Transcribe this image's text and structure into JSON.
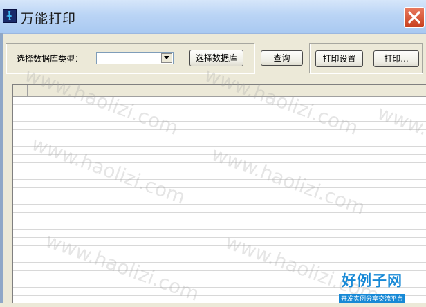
{
  "window": {
    "title": "万能打印",
    "close_icon": "close-icon",
    "app_icon": "app-icon"
  },
  "toolbar": {
    "db_type_label": "选择数据库类型：",
    "db_type_value": "",
    "select_db_button": "选择数据库",
    "query_button": "查询",
    "print_settings_button": "打印设置",
    "print_button": "打印..."
  },
  "watermark": {
    "text": "www.haolizi.com",
    "logo_main": "好例子网",
    "logo_sub": "开发实例分享交流平台"
  },
  "colors": {
    "title_bar": "#bad4f5",
    "close_button": "#d9573a",
    "window_bg": "#ece9d8",
    "logo": "#1789d6"
  }
}
